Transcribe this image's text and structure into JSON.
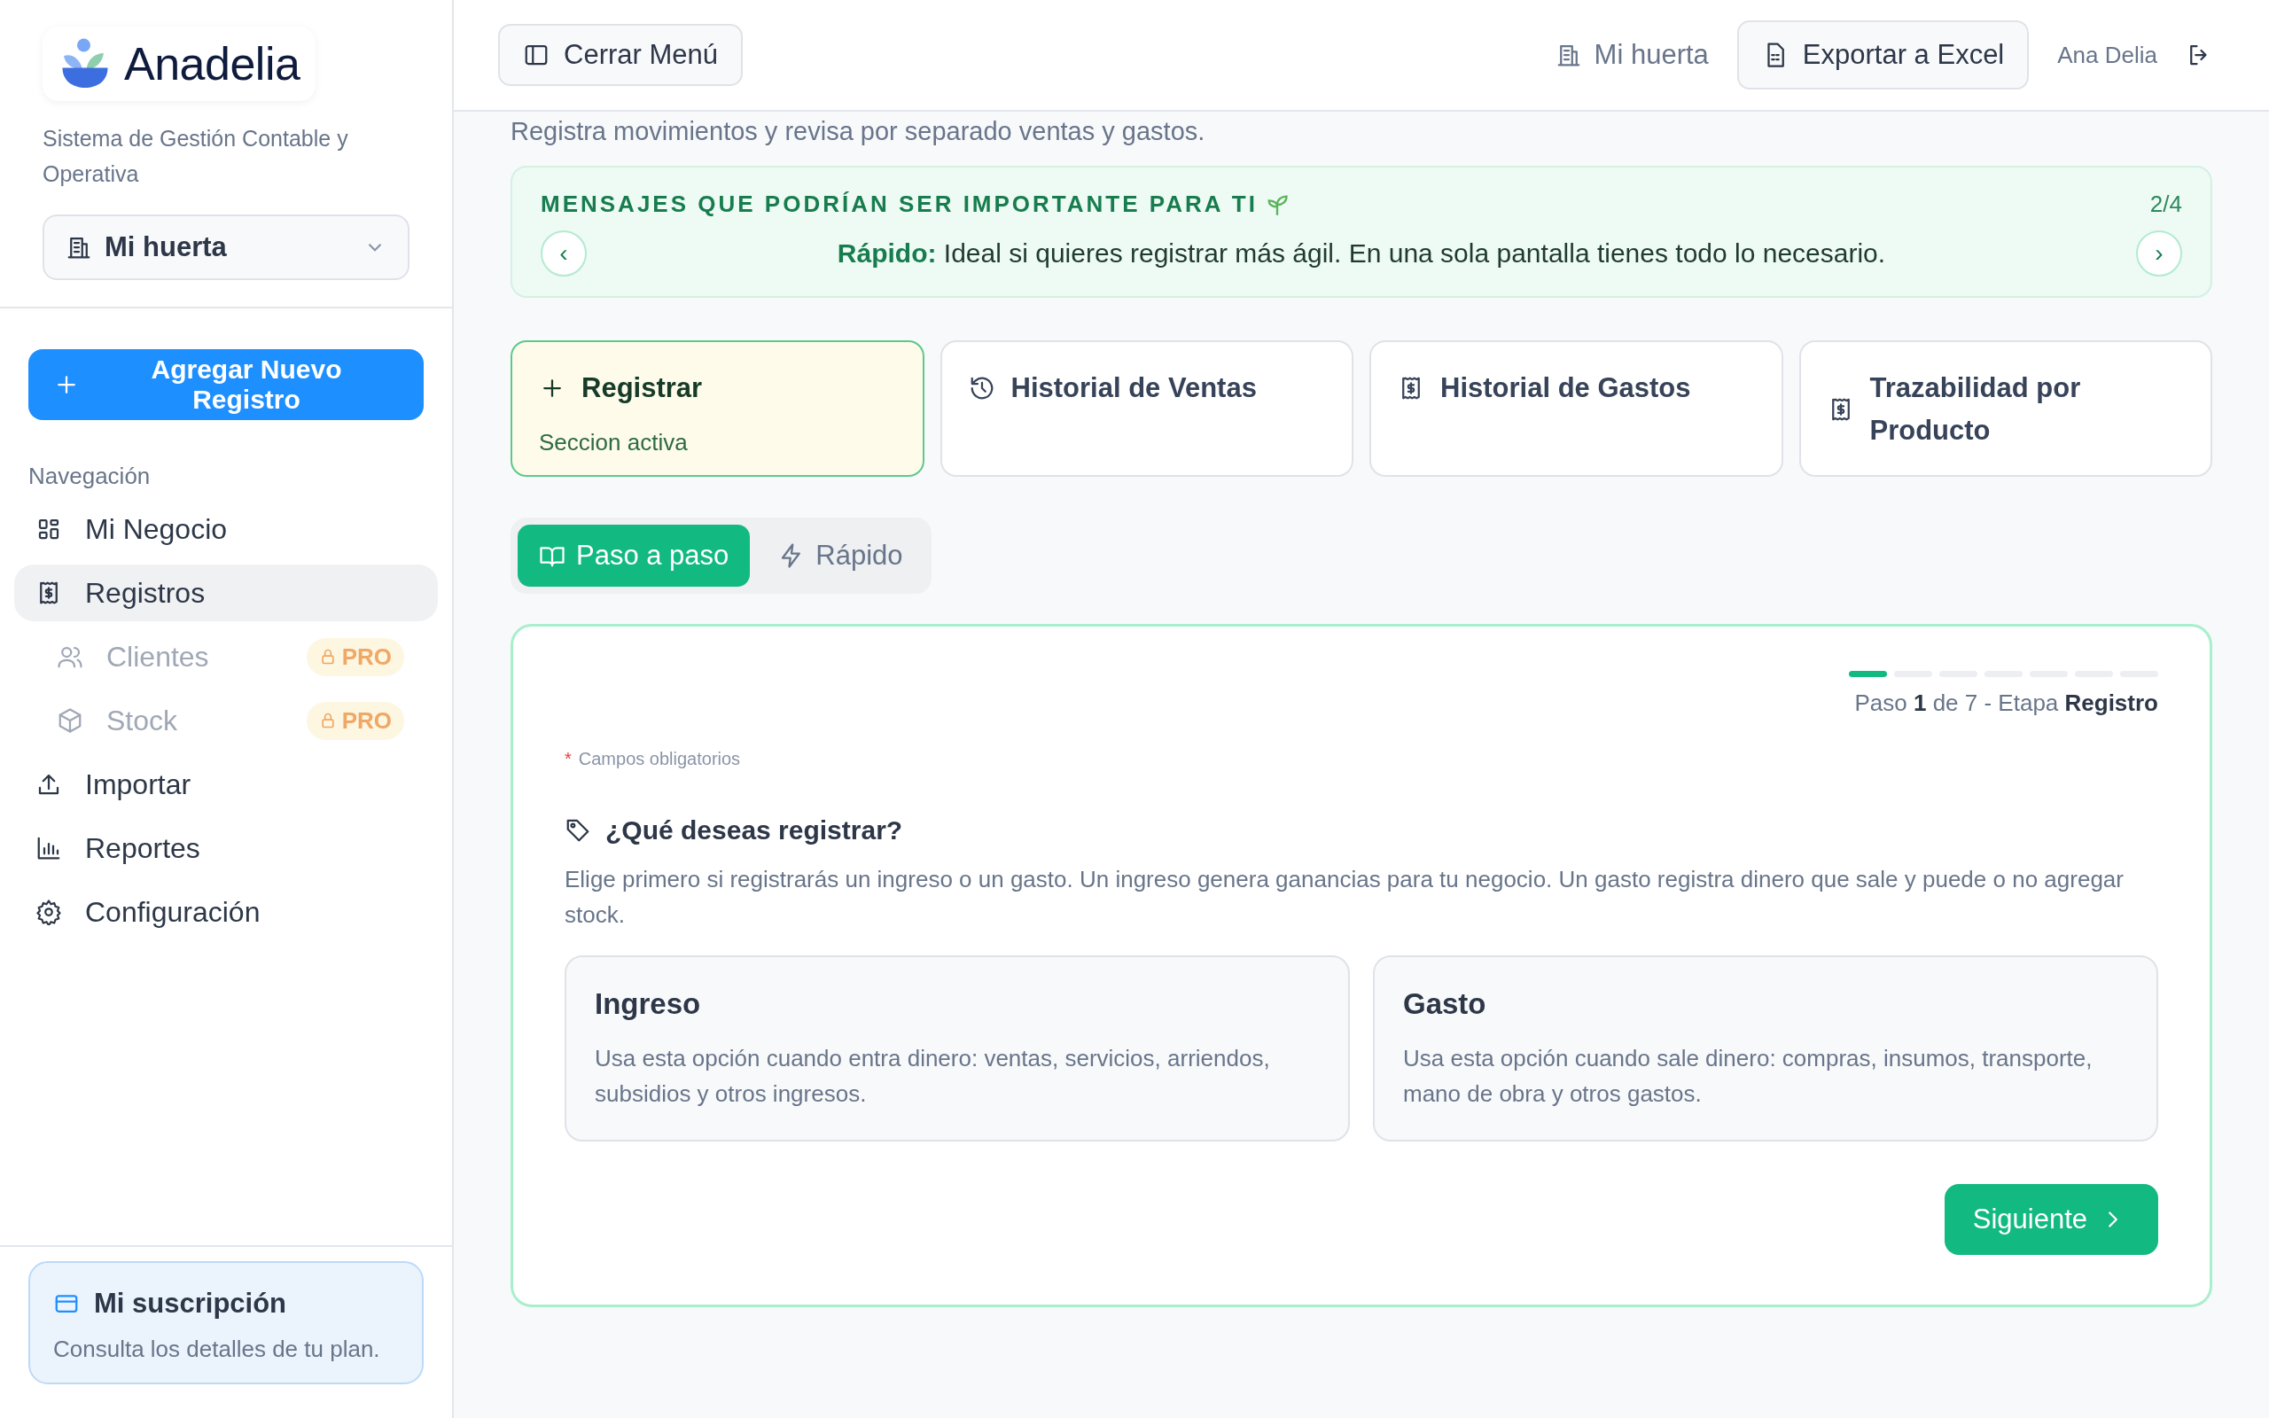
{
  "sidebar": {
    "logo_text": "Anadelia",
    "subtitle": "Sistema de Gestión Contable y Operativa",
    "business_select": {
      "value": "Mi huerta"
    },
    "add_button": "Agregar Nuevo Registro",
    "nav_heading": "Navegación",
    "nav_items": [
      {
        "label": "Mi Negocio",
        "selected": false,
        "locked": false
      },
      {
        "label": "Registros",
        "selected": true,
        "locked": false
      },
      {
        "label": "Clientes",
        "selected": false,
        "locked": true,
        "badge": "PRO"
      },
      {
        "label": "Stock",
        "selected": false,
        "locked": true,
        "badge": "PRO"
      },
      {
        "label": "Importar",
        "selected": false,
        "locked": false
      },
      {
        "label": "Reportes",
        "selected": false,
        "locked": false
      },
      {
        "label": "Configuración",
        "selected": false,
        "locked": false
      }
    ],
    "subscription": {
      "title": "Mi suscripción",
      "text": "Consulta los detalles de tu plan."
    }
  },
  "header": {
    "menu_button": "Cerrar Menú",
    "business": "Mi huerta",
    "export_button": "Exportar a Excel",
    "user": "Ana Delia"
  },
  "page_subtitle": "Registra movimientos y revisa por separado ventas y gastos.",
  "messages": {
    "title": "MENSAJES QUE PODRÍAN SER IMPORTANTE PARA TI",
    "counter": "2/4",
    "prev": "‹",
    "next": "›",
    "text": "**Rápido:** Ideal si quieres registrar más ágil. En una sola pantalla tienes todo lo necesario."
  },
  "sections": [
    {
      "label": "Registrar",
      "note": "Seccion activa",
      "selected": true
    },
    {
      "label": "Historial de Ventas",
      "selected": false
    },
    {
      "label": "Historial de Gastos",
      "selected": false
    },
    {
      "label": "Trazabilidad por Producto",
      "selected": false
    }
  ],
  "modes": [
    {
      "label": "Paso a paso",
      "selected": true
    },
    {
      "label": "Rápido",
      "selected": false
    }
  ],
  "form": {
    "steps": [
      {
        "done": true
      },
      {
        "done": false
      },
      {
        "done": false
      },
      {
        "done": false
      },
      {
        "done": false
      },
      {
        "done": false
      },
      {
        "done": false
      }
    ],
    "step_text": "Paso **1** de 7 - Etapa **Registro**",
    "required_mark": "*",
    "required_note": "Campos obligatorios",
    "question": "¿Qué deseas registrar?",
    "description": "Elige primero si registrarás un ingreso o un gasto. Un ingreso genera ganancias para tu negocio. Un gasto registra dinero que sale y puede o no agregar stock.",
    "options": [
      {
        "title": "Ingreso",
        "text": "Usa esta opción cuando entra dinero: ventas, servicios, arriendos, subsidios y otros ingresos.",
        "selected": false
      },
      {
        "title": "Gasto",
        "text": "Usa esta opción cuando sale dinero: compras, insumos, transporte, mano de obra y otros gastos.",
        "selected": false
      }
    ],
    "next_button": "Siguiente"
  }
}
